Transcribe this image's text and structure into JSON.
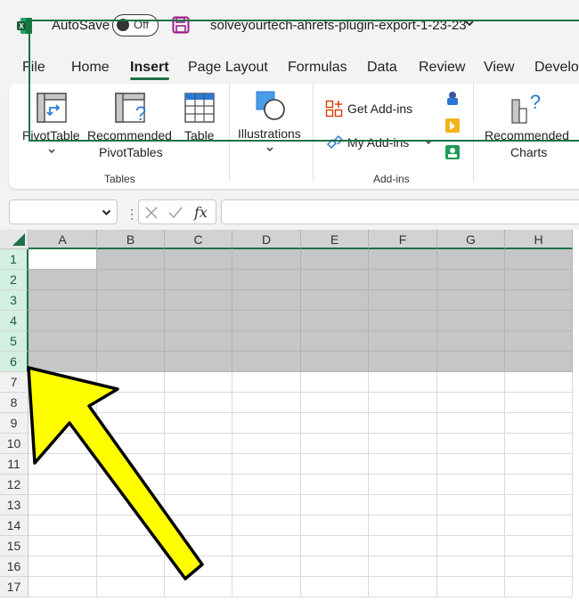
{
  "titlebar": {
    "autosave_label": "AutoSave",
    "autosave_state": "Off",
    "file_name": "solveyourtech-ahrefs-plugin-export-1-23-23"
  },
  "tabs": [
    "File",
    "Home",
    "Insert",
    "Page Layout",
    "Formulas",
    "Data",
    "Review",
    "View",
    "Develo"
  ],
  "active_tab": "Insert",
  "ribbon": {
    "tables_group": {
      "label": "Tables",
      "pivot_table": "PivotTable",
      "recommended_pivot_line1": "Recommended",
      "recommended_pivot_line2": "PivotTables",
      "table": "Table"
    },
    "illustrations": "Illustrations",
    "addins_group": {
      "label": "Add-ins",
      "get_addins": "Get Add-ins",
      "my_addins": "My Add-ins"
    },
    "charts": {
      "line1": "Recommended",
      "line2": "Charts"
    }
  },
  "formula_bar": {
    "fx_label": "fx",
    "name_box_value": "",
    "formula_value": ""
  },
  "sheet": {
    "columns": [
      "A",
      "B",
      "C",
      "D",
      "E",
      "F",
      "G",
      "H"
    ],
    "rows": [
      "1",
      "2",
      "3",
      "4",
      "5",
      "6",
      "7",
      "8",
      "9",
      "10",
      "11",
      "12",
      "13",
      "14",
      "15",
      "16",
      "17"
    ],
    "selected_rows": "1-6",
    "active_cell": "A1"
  },
  "colors": {
    "excel_green": "#1e7145",
    "selection_gray": "#c6c6c6",
    "arrow_yellow": "#ffff00"
  }
}
